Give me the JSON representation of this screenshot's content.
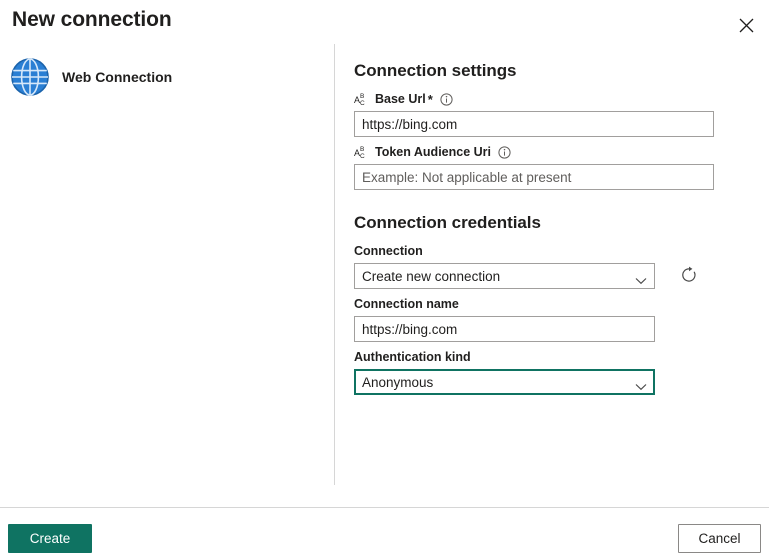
{
  "dialog": {
    "title": "New connection",
    "close_icon": "close-icon"
  },
  "left_pane": {
    "connection_type": {
      "icon": "globe-icon",
      "label": "Web Connection"
    }
  },
  "connection_settings": {
    "heading": "Connection settings",
    "fields": [
      {
        "type_icon": "abc-text-type-icon",
        "label": "Base Url",
        "required_marker": "*",
        "info_icon": "info-icon",
        "value": "https://bing.com",
        "placeholder": ""
      },
      {
        "type_icon": "abc-text-type-icon",
        "label": "Token Audience Uri",
        "required_marker": "",
        "info_icon": "info-icon",
        "value": "",
        "placeholder": "Example: Not applicable at present"
      }
    ]
  },
  "connection_credentials": {
    "heading": "Connection credentials",
    "connection": {
      "label": "Connection",
      "selected": "Create new connection",
      "chevron_icon": "chevron-down-icon",
      "refresh_icon": "refresh-icon"
    },
    "connection_name": {
      "label": "Connection name",
      "value": "https://bing.com",
      "placeholder": ""
    },
    "authentication_kind": {
      "label": "Authentication kind",
      "selected": "Anonymous",
      "chevron_icon": "chevron-down-icon"
    }
  },
  "footer": {
    "create_label": "Create",
    "cancel_label": "Cancel"
  },
  "colors": {
    "accent": "#0f7362",
    "globe_blue": "#1f6fc4",
    "border": "#a19f9d",
    "divider": "#d6d6d6",
    "text": "#201f1e"
  }
}
